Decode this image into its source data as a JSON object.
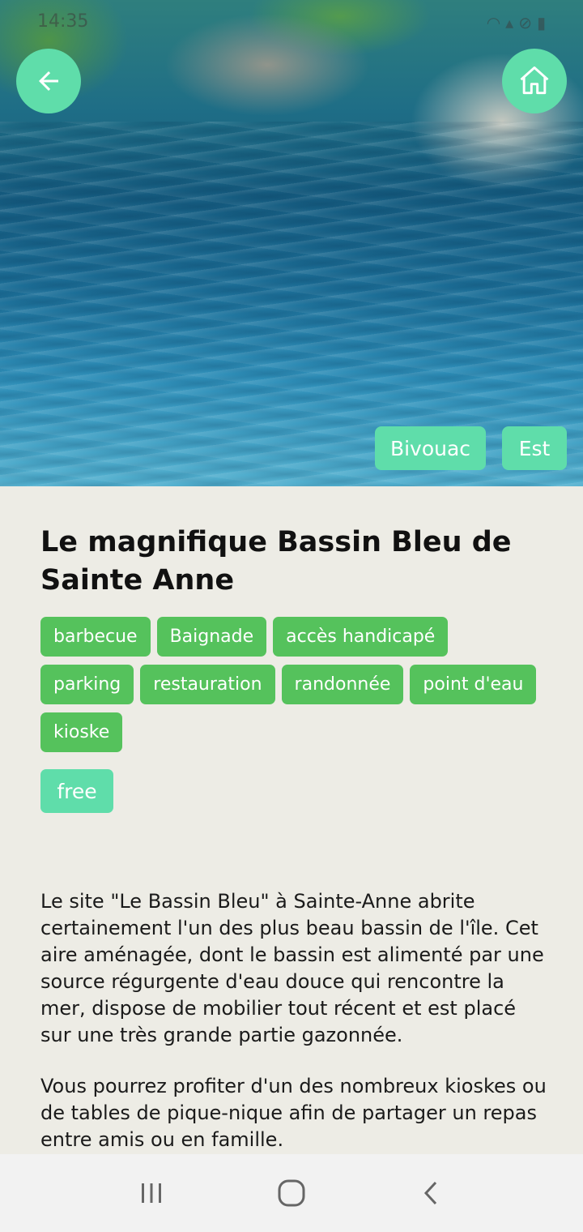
{
  "status_bar": {
    "time": "14:35",
    "icons": [
      "wifi-icon",
      "signal-icon",
      "dnd-icon",
      "battery-icon"
    ]
  },
  "hero": {
    "image": "blue-pool-photo",
    "category_label": "Bivouac",
    "region_label": "Est"
  },
  "buttons": {
    "back": "back-arrow-icon",
    "home": "home-icon"
  },
  "title": "Le magnifique Bassin Bleu de Sainte Anne",
  "tags": [
    "barbecue",
    "Baignade",
    "accès handicapé",
    "parking",
    "restauration",
    "randonnée",
    "point d'eau",
    "kioske"
  ],
  "price": "free",
  "description": {
    "paragraph_1": "Le site \"Le Bassin Bleu\" à Sainte-Anne abrite certainement l'un des plus beau bassin de l'île. Cet aire aménagée, dont le bassin est alimenté par une source régurgente d'eau douce qui rencontre la mer, dispose de mobilier tout récent et est placé sur une très grande partie gazonnée.",
    "paragraph_2": "Vous pourrez profiter d'un des nombreux kioskes ou de tables de pique-nique afin de partager un repas entre amis ou en famille."
  },
  "nav_bar": [
    "recent-apps-icon",
    "home-circle-icon",
    "back-chevron-icon"
  ],
  "colors": {
    "accent": "#5fddaa",
    "tag_green": "#55c25c",
    "background": "#edece5"
  }
}
